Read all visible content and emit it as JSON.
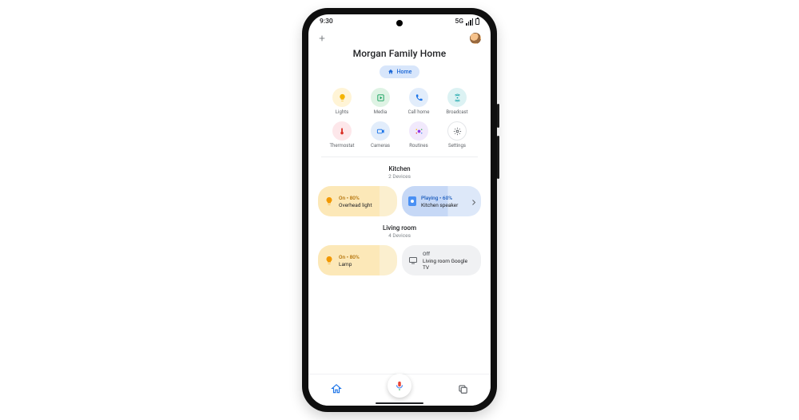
{
  "status": {
    "time": "9:30",
    "net": "5G"
  },
  "header": {
    "title": "Morgan Family Home"
  },
  "chip": {
    "label": "Home"
  },
  "quick": [
    {
      "label": "Lights",
      "icon": "bulb",
      "cls": "c-yellow",
      "color": "#f4b400"
    },
    {
      "label": "Media",
      "icon": "media",
      "cls": "c-green",
      "color": "#0f9d58"
    },
    {
      "label": "Call home",
      "icon": "phone",
      "cls": "c-blue",
      "color": "#1a73e8"
    },
    {
      "label": "Broadcast",
      "icon": "broadcast",
      "cls": "c-teal",
      "color": "#12a3a8"
    },
    {
      "label": "Thermostat",
      "icon": "thermo",
      "cls": "c-pink",
      "color": "#d93025"
    },
    {
      "label": "Cameras",
      "icon": "camera",
      "cls": "c-blue",
      "color": "#1a73e8"
    },
    {
      "label": "Routines",
      "icon": "routines",
      "cls": "c-purple",
      "color": "#9334e6"
    },
    {
      "label": "Settings",
      "icon": "gear",
      "cls": "c-white",
      "color": "#5f6368"
    }
  ],
  "rooms": [
    {
      "name": "Kitchen",
      "count": "2 Devices",
      "cards": [
        {
          "kind": "light-on",
          "icon": "bulb-on",
          "status": "On • 80%",
          "name": "Overhead light"
        },
        {
          "kind": "speaker-on",
          "icon": "speaker",
          "status": "Playing • 60%",
          "name": "Kitchen speaker",
          "chevron": true
        }
      ]
    },
    {
      "name": "Living room",
      "count": "4 Devices",
      "cards": [
        {
          "kind": "light-on",
          "icon": "bulb-on",
          "status": "On • 80%",
          "name": "Lamp"
        },
        {
          "kind": "card-grey",
          "icon": "tv",
          "status": "Off",
          "name": "Living room Google TV"
        }
      ]
    }
  ]
}
